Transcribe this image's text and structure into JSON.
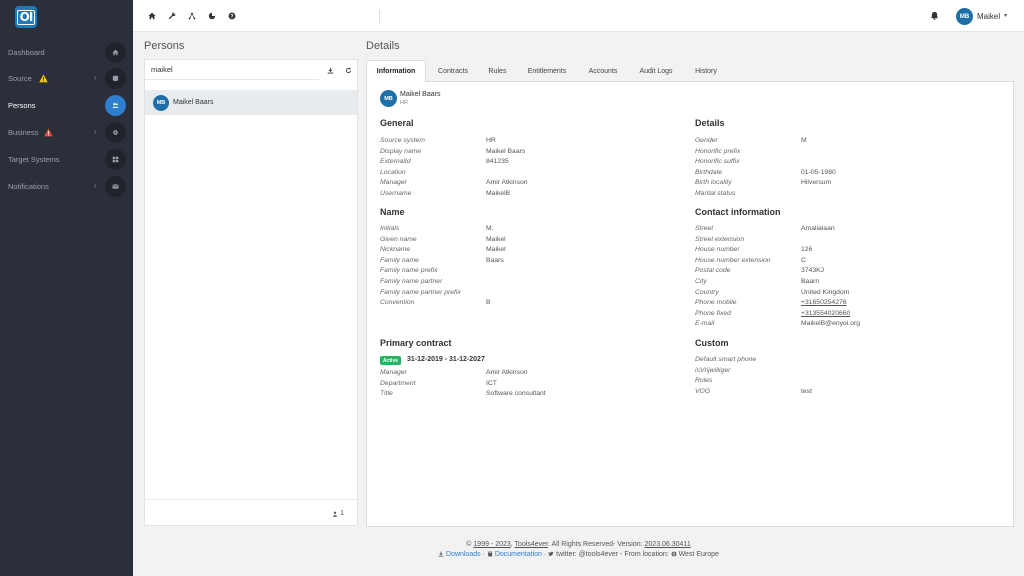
{
  "app": {
    "logo_text": "OI"
  },
  "sidebar": {
    "items": [
      {
        "label": "Dashboard"
      },
      {
        "label": "Source"
      },
      {
        "label": "Persons"
      },
      {
        "label": "Business"
      },
      {
        "label": "Target Systems"
      },
      {
        "label": "Notifications"
      }
    ]
  },
  "topbar": {
    "user_initials": "MB",
    "user_name": "Maikel"
  },
  "persons": {
    "title": "Persons",
    "search_value": "maikel",
    "list": [
      {
        "initials": "MB",
        "name": "Maikel Baars"
      }
    ],
    "count": "1"
  },
  "details": {
    "title": "Details",
    "tabs": [
      "Information",
      "Contracts",
      "Rules",
      "Entitlements",
      "Accounts",
      "Audit Logs",
      "History"
    ],
    "header": {
      "initials": "MB",
      "name": "Maikel Baars",
      "source": "HR"
    },
    "general": {
      "title": "General",
      "fields": [
        {
          "label": "Source system",
          "value": "HR"
        },
        {
          "label": "Display name",
          "value": "Maikel Baars"
        },
        {
          "label": "ExternalId",
          "value": "841235"
        },
        {
          "label": "Location",
          "value": ""
        },
        {
          "label": "Manager",
          "value": "Amir Atkinson"
        },
        {
          "label": "Username",
          "value": "MaikelB"
        }
      ]
    },
    "name": {
      "title": "Name",
      "fields": [
        {
          "label": "Initials",
          "value": "M."
        },
        {
          "label": "Given name",
          "value": "Maikel"
        },
        {
          "label": "Nickname",
          "value": "Maikel"
        },
        {
          "label": "Family name",
          "value": "Baars"
        },
        {
          "label": "Family name prefix",
          "value": ""
        },
        {
          "label": "Family name partner",
          "value": ""
        },
        {
          "label": "Family name partner prefix",
          "value": ""
        },
        {
          "label": "Convention",
          "value": "B"
        }
      ]
    },
    "primary_contract": {
      "title": "Primary contract",
      "status": "Active",
      "dates": "31-12-2019 - 31-12-2027",
      "fields": [
        {
          "label": "Manager",
          "value": "Amir Atkinson"
        },
        {
          "label": "Department",
          "value": "ICT"
        },
        {
          "label": "Title",
          "value": "Software consultant"
        }
      ]
    },
    "details_section": {
      "title": "Details",
      "fields": [
        {
          "label": "Gender",
          "value": "M"
        },
        {
          "label": "Honorific prefix",
          "value": ""
        },
        {
          "label": "Honorific suffix",
          "value": ""
        },
        {
          "label": "Birthdate",
          "value": "01-05-1980"
        },
        {
          "label": "Birth locality",
          "value": "Hilversum"
        },
        {
          "label": "Marital status",
          "value": ""
        }
      ]
    },
    "contact": {
      "title": "Contact information",
      "fields": [
        {
          "label": "Street",
          "value": "Amalialaan"
        },
        {
          "label": "Street extension",
          "value": ""
        },
        {
          "label": "House number",
          "value": "126"
        },
        {
          "label": "House number extension",
          "value": "C"
        },
        {
          "label": "Postal code",
          "value": "3743KJ"
        },
        {
          "label": "City",
          "value": "Baarn"
        },
        {
          "label": "Country",
          "value": "United Kingdom"
        },
        {
          "label": "Phone mobile",
          "value": "+31650254276"
        },
        {
          "label": "Phone fixed",
          "value": "+313554020660"
        },
        {
          "label": "E-mail",
          "value": "MaikelB@enyoi.org"
        }
      ]
    },
    "custom": {
      "title": "Custom",
      "fields": [
        {
          "label": "Default smart phone",
          "value": ""
        },
        {
          "label": "isVrijwilliger",
          "value": ""
        },
        {
          "label": "Roles",
          "value": ""
        },
        {
          "label": "VOG",
          "value": "test"
        }
      ]
    }
  },
  "footer": {
    "copyright_symbol": "©",
    "years": "1999 - 2023",
    "company": "Tools4ever",
    "rights": ". All Rights Reserved- Version:",
    "version": "2023.06.30411",
    "downloads": "Downloads",
    "documentation": "Documentation",
    "twitter": "twitter: @tools4ever",
    "from_location": "- From location:",
    "location": "West Europe"
  },
  "colors": {
    "sidebar_bg": "#2b2f3a",
    "accent": "#2e7fd0",
    "avatar": "#1e6fa8",
    "active_badge": "#28b463",
    "warning": "#f1c40f",
    "danger": "#e74c3c"
  }
}
